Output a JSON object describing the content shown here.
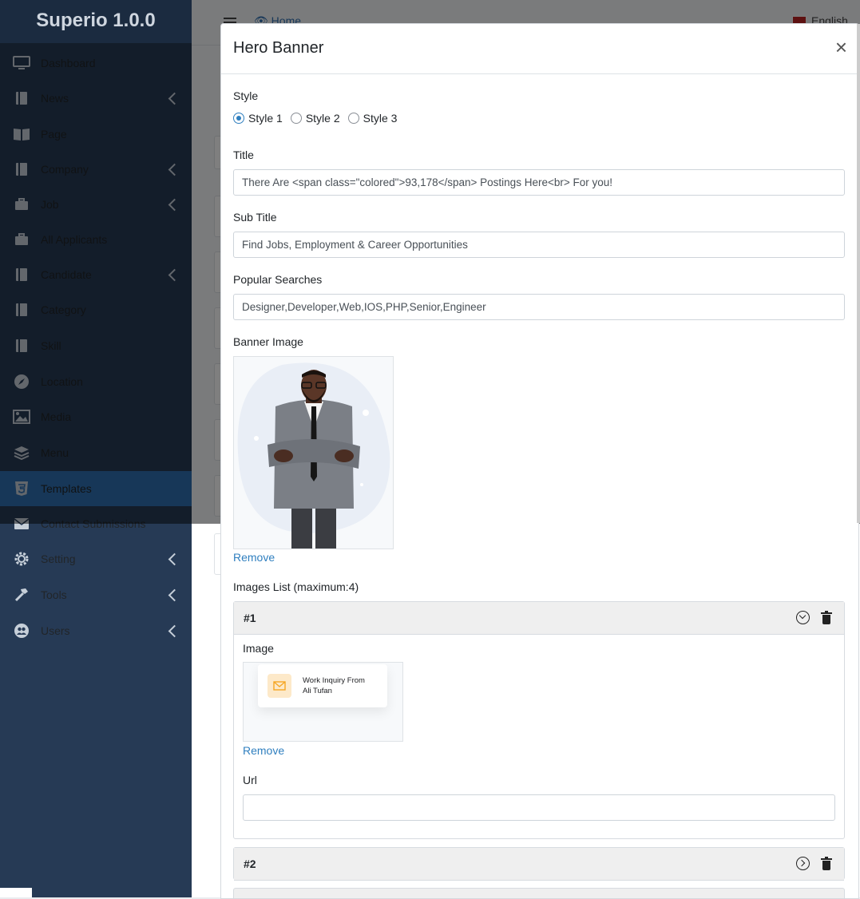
{
  "app": {
    "brand": "Superio 1.0.0"
  },
  "sidebar": {
    "items": [
      {
        "label": "Dashboard",
        "icon": "monitor-icon",
        "chevron": false
      },
      {
        "label": "News",
        "icon": "book-icon",
        "chevron": true
      },
      {
        "label": "Page",
        "icon": "book-open-icon",
        "chevron": false
      },
      {
        "label": "Company",
        "icon": "book-icon",
        "chevron": true
      },
      {
        "label": "Job",
        "icon": "briefcase-icon",
        "chevron": true
      },
      {
        "label": "All Applicants",
        "icon": "briefcase-icon",
        "chevron": false
      },
      {
        "label": "Candidate",
        "icon": "book-icon",
        "chevron": true
      },
      {
        "label": "Category",
        "icon": "book-icon",
        "chevron": false
      },
      {
        "label": "Skill",
        "icon": "book-icon",
        "chevron": false
      },
      {
        "label": "Location",
        "icon": "compass-icon",
        "chevron": false
      },
      {
        "label": "Media",
        "icon": "image-icon",
        "chevron": false
      },
      {
        "label": "Menu",
        "icon": "layers-icon",
        "chevron": false
      },
      {
        "label": "Templates",
        "icon": "html5-icon",
        "chevron": false,
        "active": true
      },
      {
        "label": "Contact Submissions",
        "icon": "envelope-icon",
        "chevron": false
      },
      {
        "label": "Setting",
        "icon": "gear-icon",
        "chevron": true
      },
      {
        "label": "Tools",
        "icon": "hammer-icon",
        "chevron": true
      },
      {
        "label": "Users",
        "icon": "users-icon",
        "chevron": true
      }
    ]
  },
  "topbar": {
    "home": "Home",
    "language": "English"
  },
  "modal": {
    "title": "Hero Banner",
    "close": "×",
    "style_label": "Style",
    "style_options": [
      "Style 1",
      "Style 2",
      "Style 3"
    ],
    "style_selected": "Style 1",
    "title_label": "Title",
    "title_value": "There Are <span class=\"colored\">93,178</span> Postings Here<br> For you!",
    "subtitle_label": "Sub Title",
    "subtitle_value": "Find Jobs, Employment & Career Opportunities",
    "popular_label": "Popular Searches",
    "popular_value": "Designer,Developer,Web,IOS,PHP,Senior,Engineer",
    "banner_image_label": "Banner Image",
    "remove_label": "Remove",
    "images_list_label": "Images List (maximum:4)",
    "items": [
      {
        "num": "#1",
        "image_label": "Image",
        "card_text_1": "Work Inquiry From",
        "card_text_2": "Ali Tufan",
        "remove": "Remove",
        "url_label": "Url",
        "url_value": ""
      },
      {
        "num": "#2"
      }
    ]
  },
  "colors": {
    "sidebar_bg": "#263a55",
    "active": "#2e6fb0",
    "link": "#2f7fbf"
  }
}
